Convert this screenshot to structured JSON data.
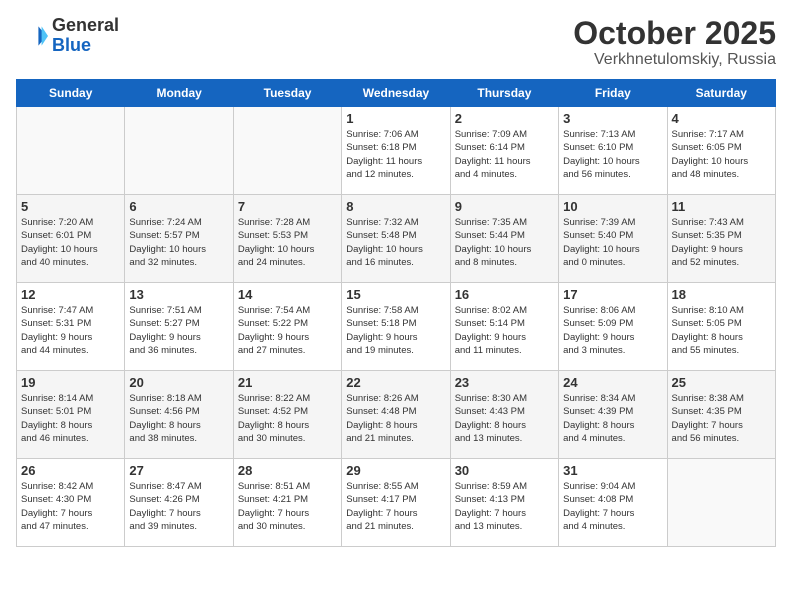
{
  "header": {
    "logo_general": "General",
    "logo_blue": "Blue",
    "month": "October 2025",
    "location": "Verkhnetulomskiy, Russia"
  },
  "weekdays": [
    "Sunday",
    "Monday",
    "Tuesday",
    "Wednesday",
    "Thursday",
    "Friday",
    "Saturday"
  ],
  "weeks": [
    [
      {
        "day": "",
        "info": ""
      },
      {
        "day": "",
        "info": ""
      },
      {
        "day": "",
        "info": ""
      },
      {
        "day": "1",
        "info": "Sunrise: 7:06 AM\nSunset: 6:18 PM\nDaylight: 11 hours\nand 12 minutes."
      },
      {
        "day": "2",
        "info": "Sunrise: 7:09 AM\nSunset: 6:14 PM\nDaylight: 11 hours\nand 4 minutes."
      },
      {
        "day": "3",
        "info": "Sunrise: 7:13 AM\nSunset: 6:10 PM\nDaylight: 10 hours\nand 56 minutes."
      },
      {
        "day": "4",
        "info": "Sunrise: 7:17 AM\nSunset: 6:05 PM\nDaylight: 10 hours\nand 48 minutes."
      }
    ],
    [
      {
        "day": "5",
        "info": "Sunrise: 7:20 AM\nSunset: 6:01 PM\nDaylight: 10 hours\nand 40 minutes."
      },
      {
        "day": "6",
        "info": "Sunrise: 7:24 AM\nSunset: 5:57 PM\nDaylight: 10 hours\nand 32 minutes."
      },
      {
        "day": "7",
        "info": "Sunrise: 7:28 AM\nSunset: 5:53 PM\nDaylight: 10 hours\nand 24 minutes."
      },
      {
        "day": "8",
        "info": "Sunrise: 7:32 AM\nSunset: 5:48 PM\nDaylight: 10 hours\nand 16 minutes."
      },
      {
        "day": "9",
        "info": "Sunrise: 7:35 AM\nSunset: 5:44 PM\nDaylight: 10 hours\nand 8 minutes."
      },
      {
        "day": "10",
        "info": "Sunrise: 7:39 AM\nSunset: 5:40 PM\nDaylight: 10 hours\nand 0 minutes."
      },
      {
        "day": "11",
        "info": "Sunrise: 7:43 AM\nSunset: 5:35 PM\nDaylight: 9 hours\nand 52 minutes."
      }
    ],
    [
      {
        "day": "12",
        "info": "Sunrise: 7:47 AM\nSunset: 5:31 PM\nDaylight: 9 hours\nand 44 minutes."
      },
      {
        "day": "13",
        "info": "Sunrise: 7:51 AM\nSunset: 5:27 PM\nDaylight: 9 hours\nand 36 minutes."
      },
      {
        "day": "14",
        "info": "Sunrise: 7:54 AM\nSunset: 5:22 PM\nDaylight: 9 hours\nand 27 minutes."
      },
      {
        "day": "15",
        "info": "Sunrise: 7:58 AM\nSunset: 5:18 PM\nDaylight: 9 hours\nand 19 minutes."
      },
      {
        "day": "16",
        "info": "Sunrise: 8:02 AM\nSunset: 5:14 PM\nDaylight: 9 hours\nand 11 minutes."
      },
      {
        "day": "17",
        "info": "Sunrise: 8:06 AM\nSunset: 5:09 PM\nDaylight: 9 hours\nand 3 minutes."
      },
      {
        "day": "18",
        "info": "Sunrise: 8:10 AM\nSunset: 5:05 PM\nDaylight: 8 hours\nand 55 minutes."
      }
    ],
    [
      {
        "day": "19",
        "info": "Sunrise: 8:14 AM\nSunset: 5:01 PM\nDaylight: 8 hours\nand 46 minutes."
      },
      {
        "day": "20",
        "info": "Sunrise: 8:18 AM\nSunset: 4:56 PM\nDaylight: 8 hours\nand 38 minutes."
      },
      {
        "day": "21",
        "info": "Sunrise: 8:22 AM\nSunset: 4:52 PM\nDaylight: 8 hours\nand 30 minutes."
      },
      {
        "day": "22",
        "info": "Sunrise: 8:26 AM\nSunset: 4:48 PM\nDaylight: 8 hours\nand 21 minutes."
      },
      {
        "day": "23",
        "info": "Sunrise: 8:30 AM\nSunset: 4:43 PM\nDaylight: 8 hours\nand 13 minutes."
      },
      {
        "day": "24",
        "info": "Sunrise: 8:34 AM\nSunset: 4:39 PM\nDaylight: 8 hours\nand 4 minutes."
      },
      {
        "day": "25",
        "info": "Sunrise: 8:38 AM\nSunset: 4:35 PM\nDaylight: 7 hours\nand 56 minutes."
      }
    ],
    [
      {
        "day": "26",
        "info": "Sunrise: 8:42 AM\nSunset: 4:30 PM\nDaylight: 7 hours\nand 47 minutes."
      },
      {
        "day": "27",
        "info": "Sunrise: 8:47 AM\nSunset: 4:26 PM\nDaylight: 7 hours\nand 39 minutes."
      },
      {
        "day": "28",
        "info": "Sunrise: 8:51 AM\nSunset: 4:21 PM\nDaylight: 7 hours\nand 30 minutes."
      },
      {
        "day": "29",
        "info": "Sunrise: 8:55 AM\nSunset: 4:17 PM\nDaylight: 7 hours\nand 21 minutes."
      },
      {
        "day": "30",
        "info": "Sunrise: 8:59 AM\nSunset: 4:13 PM\nDaylight: 7 hours\nand 13 minutes."
      },
      {
        "day": "31",
        "info": "Sunrise: 9:04 AM\nSunset: 4:08 PM\nDaylight: 7 hours\nand 4 minutes."
      },
      {
        "day": "",
        "info": ""
      }
    ]
  ]
}
